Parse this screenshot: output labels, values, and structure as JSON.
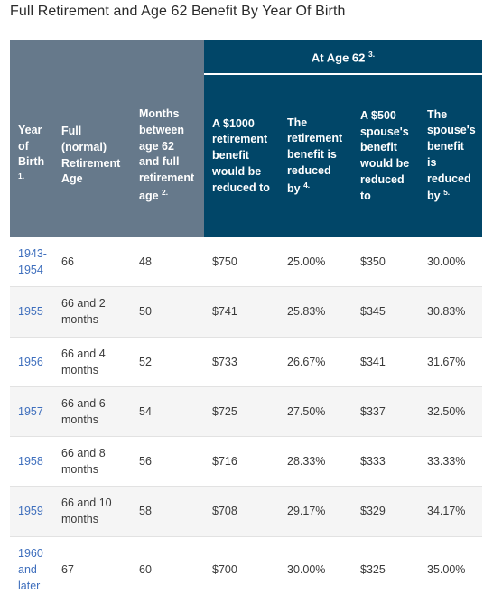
{
  "page_title": "Full Retirement and Age 62 Benefit By Year Of Birth",
  "colors": {
    "header_gray": "#66798b",
    "header_navy": "#014668",
    "link_blue": "#3f6fbd",
    "alt_row": "#f5f5f5",
    "text": "#3a3a3a"
  },
  "table": {
    "group_header": {
      "blank_label": "",
      "at_age_62": "At Age 62",
      "at_age_62_sup": "3."
    },
    "columns": [
      {
        "label": "Year of Birth",
        "sup": "1.",
        "group": "gray"
      },
      {
        "label": "Full (normal) Retirement Age",
        "sup": "",
        "group": "gray"
      },
      {
        "label": "Months between age 62 and full retirement age",
        "sup": "2.",
        "group": "gray"
      },
      {
        "label": "A $1000 retirement benefit would be reduced to",
        "sup": "",
        "group": "navy"
      },
      {
        "label": "The retirement benefit is reduced by",
        "sup": "4.",
        "group": "navy"
      },
      {
        "label": "A $500 spouse's benefit would be reduced to",
        "sup": "",
        "group": "navy"
      },
      {
        "label": "The spouse's benefit is reduced by",
        "sup": "5.",
        "group": "navy"
      }
    ],
    "rows": [
      {
        "year_of_birth": "1943-1954",
        "full_retirement_age": "66",
        "months_between": "48",
        "retirement_benefit_reduced_to": "$750",
        "retirement_benefit_reduced_by": "25.00%",
        "spouse_benefit_reduced_to": "$350",
        "spouse_benefit_reduced_by": "30.00%"
      },
      {
        "year_of_birth": "1955",
        "full_retirement_age": "66 and 2 months",
        "months_between": "50",
        "retirement_benefit_reduced_to": "$741",
        "retirement_benefit_reduced_by": "25.83%",
        "spouse_benefit_reduced_to": "$345",
        "spouse_benefit_reduced_by": "30.83%"
      },
      {
        "year_of_birth": "1956",
        "full_retirement_age": "66 and 4 months",
        "months_between": "52",
        "retirement_benefit_reduced_to": "$733",
        "retirement_benefit_reduced_by": "26.67%",
        "spouse_benefit_reduced_to": "$341",
        "spouse_benefit_reduced_by": "31.67%"
      },
      {
        "year_of_birth": "1957",
        "full_retirement_age": "66 and 6 months",
        "months_between": "54",
        "retirement_benefit_reduced_to": "$725",
        "retirement_benefit_reduced_by": "27.50%",
        "spouse_benefit_reduced_to": "$337",
        "spouse_benefit_reduced_by": "32.50%"
      },
      {
        "year_of_birth": "1958",
        "full_retirement_age": "66 and 8 months",
        "months_between": "56",
        "retirement_benefit_reduced_to": "$716",
        "retirement_benefit_reduced_by": "28.33%",
        "spouse_benefit_reduced_to": "$333",
        "spouse_benefit_reduced_by": "33.33%"
      },
      {
        "year_of_birth": "1959",
        "full_retirement_age": "66 and 10 months",
        "months_between": "58",
        "retirement_benefit_reduced_to": "$708",
        "retirement_benefit_reduced_by": "29.17%",
        "spouse_benefit_reduced_to": "$329",
        "spouse_benefit_reduced_by": "34.17%"
      },
      {
        "year_of_birth": "1960 and later",
        "full_retirement_age": "67",
        "months_between": "60",
        "retirement_benefit_reduced_to": "$700",
        "retirement_benefit_reduced_by": "30.00%",
        "spouse_benefit_reduced_to": "$325",
        "spouse_benefit_reduced_by": "35.00%"
      }
    ]
  }
}
